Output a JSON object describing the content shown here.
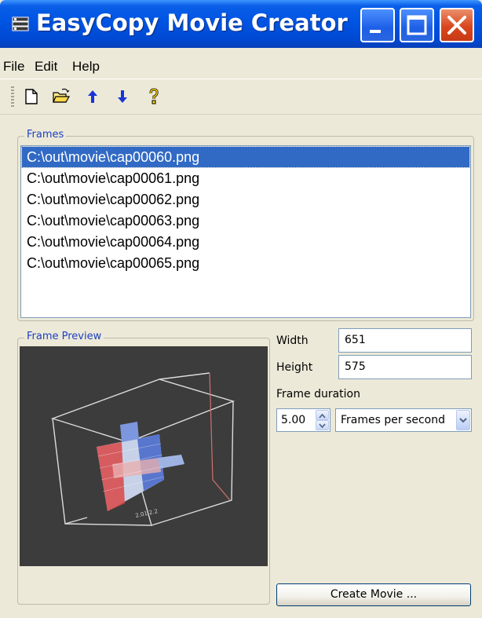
{
  "window": {
    "title": "EasyCopy Movie Creator",
    "app_icon": "app-icon",
    "controls": {
      "minimize": "minimize-icon",
      "maximize": "maximize-icon",
      "close": "close-icon"
    }
  },
  "menu": {
    "items": [
      "File",
      "Edit",
      "Help"
    ]
  },
  "toolbar": {
    "tools": [
      "new-file-icon",
      "open-folder-icon",
      "move-up-icon",
      "move-down-icon",
      "help-icon"
    ]
  },
  "frames": {
    "label": "Frames",
    "selected_index": 0,
    "items": [
      "C:\\out\\movie\\cap00060.png",
      "C:\\out\\movie\\cap00061.png",
      "C:\\out\\movie\\cap00062.png",
      "C:\\out\\movie\\cap00063.png",
      "C:\\out\\movie\\cap00064.png",
      "C:\\out\\movie\\cap00065.png"
    ]
  },
  "preview": {
    "label": "Frame Preview"
  },
  "settings": {
    "width_label": "Width",
    "width_value": "651",
    "height_label": "Height",
    "height_value": "575",
    "duration_label": "Frame duration",
    "duration_value": "5.00",
    "duration_unit": "Frames per second"
  },
  "actions": {
    "create_label": "Create Movie ..."
  },
  "colors": {
    "titlebar": "#0054e3",
    "selection": "#316ac5",
    "group_label": "#1d40c2",
    "background": "#ece9d8"
  }
}
